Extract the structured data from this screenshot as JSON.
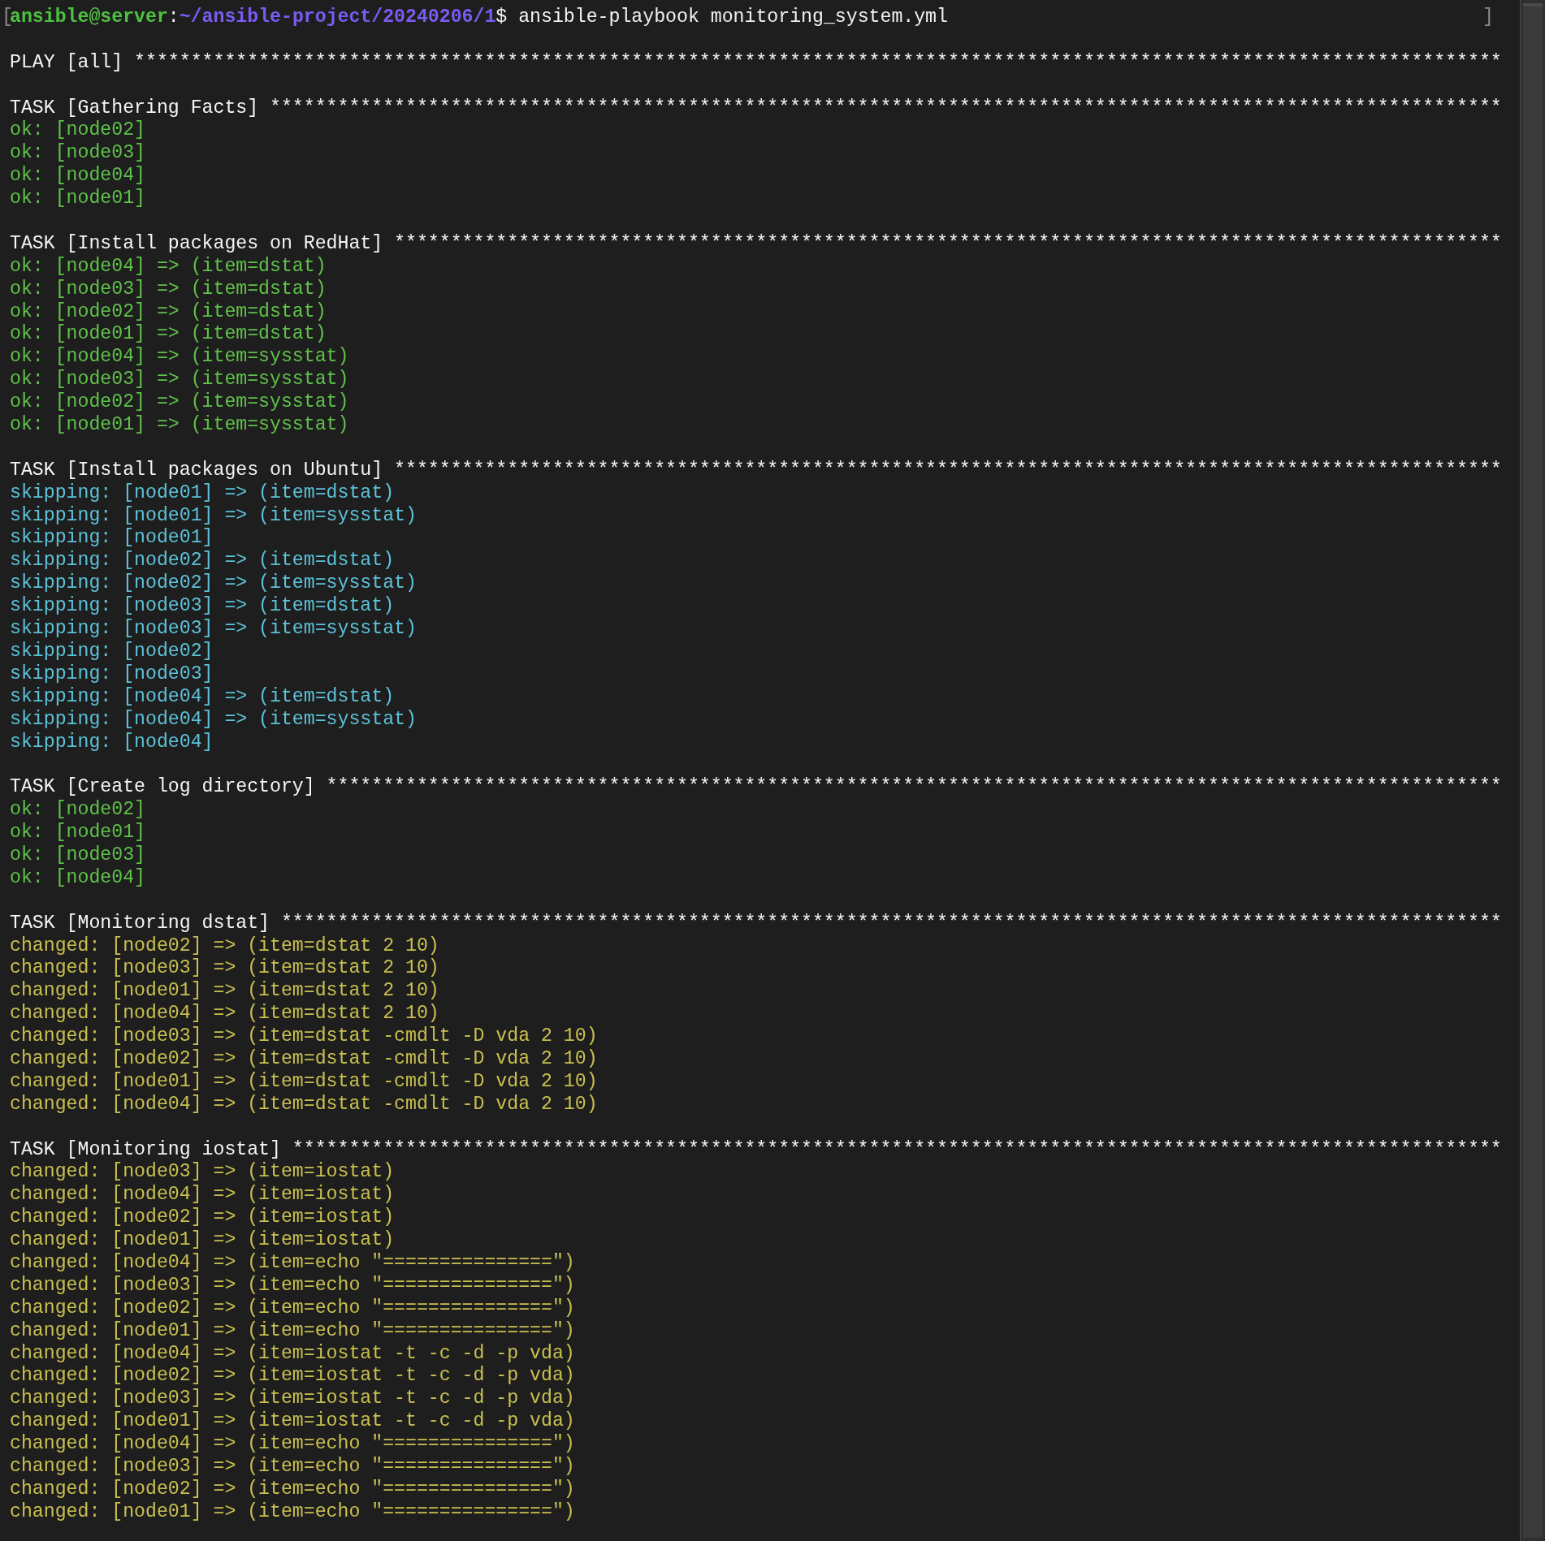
{
  "prompt": {
    "mark_open": "[",
    "user_host": "ansible@server",
    "separator": ":",
    "path": "~/ansible-project/20240206/1",
    "command": "$ ansible-playbook monitoring_system.yml",
    "mark_close": "]"
  },
  "sections": [
    {
      "header": "PLAY [all] *************************************************************************************************************************"
    },
    {
      "header": "TASK [Gathering Facts] *************************************************************************************************************",
      "results": [
        {
          "kind": "ok",
          "text": "ok: [node02]"
        },
        {
          "kind": "ok",
          "text": "ok: [node03]"
        },
        {
          "kind": "ok",
          "text": "ok: [node04]"
        },
        {
          "kind": "ok",
          "text": "ok: [node01]"
        }
      ]
    },
    {
      "header": "TASK [Install packages on RedHat] **************************************************************************************************",
      "results": [
        {
          "kind": "ok",
          "text": "ok: [node04] => (item=dstat)"
        },
        {
          "kind": "ok",
          "text": "ok: [node03] => (item=dstat)"
        },
        {
          "kind": "ok",
          "text": "ok: [node02] => (item=dstat)"
        },
        {
          "kind": "ok",
          "text": "ok: [node01] => (item=dstat)"
        },
        {
          "kind": "ok",
          "text": "ok: [node04] => (item=sysstat)"
        },
        {
          "kind": "ok",
          "text": "ok: [node03] => (item=sysstat)"
        },
        {
          "kind": "ok",
          "text": "ok: [node02] => (item=sysstat)"
        },
        {
          "kind": "ok",
          "text": "ok: [node01] => (item=sysstat)"
        }
      ]
    },
    {
      "header": "TASK [Install packages on Ubuntu] **************************************************************************************************",
      "results": [
        {
          "kind": "skipping",
          "text": "skipping: [node01] => (item=dstat)"
        },
        {
          "kind": "skipping",
          "text": "skipping: [node01] => (item=sysstat)"
        },
        {
          "kind": "skipping",
          "text": "skipping: [node01]"
        },
        {
          "kind": "skipping",
          "text": "skipping: [node02] => (item=dstat)"
        },
        {
          "kind": "skipping",
          "text": "skipping: [node02] => (item=sysstat)"
        },
        {
          "kind": "skipping",
          "text": "skipping: [node03] => (item=dstat)"
        },
        {
          "kind": "skipping",
          "text": "skipping: [node03] => (item=sysstat)"
        },
        {
          "kind": "skipping",
          "text": "skipping: [node02]"
        },
        {
          "kind": "skipping",
          "text": "skipping: [node03]"
        },
        {
          "kind": "skipping",
          "text": "skipping: [node04] => (item=dstat)"
        },
        {
          "kind": "skipping",
          "text": "skipping: [node04] => (item=sysstat)"
        },
        {
          "kind": "skipping",
          "text": "skipping: [node04]"
        }
      ]
    },
    {
      "header": "TASK [Create log directory] ********************************************************************************************************",
      "results": [
        {
          "kind": "ok",
          "text": "ok: [node02]"
        },
        {
          "kind": "ok",
          "text": "ok: [node01]"
        },
        {
          "kind": "ok",
          "text": "ok: [node03]"
        },
        {
          "kind": "ok",
          "text": "ok: [node04]"
        }
      ]
    },
    {
      "header": "TASK [Monitoring dstat] ************************************************************************************************************",
      "results": [
        {
          "kind": "changed",
          "text": "changed: [node02] => (item=dstat 2 10)"
        },
        {
          "kind": "changed",
          "text": "changed: [node03] => (item=dstat 2 10)"
        },
        {
          "kind": "changed",
          "text": "changed: [node01] => (item=dstat 2 10)"
        },
        {
          "kind": "changed",
          "text": "changed: [node04] => (item=dstat 2 10)"
        },
        {
          "kind": "changed",
          "text": "changed: [node03] => (item=dstat -cmdlt -D vda 2 10)"
        },
        {
          "kind": "changed",
          "text": "changed: [node02] => (item=dstat -cmdlt -D vda 2 10)"
        },
        {
          "kind": "changed",
          "text": "changed: [node01] => (item=dstat -cmdlt -D vda 2 10)"
        },
        {
          "kind": "changed",
          "text": "changed: [node04] => (item=dstat -cmdlt -D vda 2 10)"
        }
      ]
    },
    {
      "header": "TASK [Monitoring iostat] ***********************************************************************************************************",
      "results": [
        {
          "kind": "changed",
          "text": "changed: [node03] => (item=iostat)"
        },
        {
          "kind": "changed",
          "text": "changed: [node04] => (item=iostat)"
        },
        {
          "kind": "changed",
          "text": "changed: [node02] => (item=iostat)"
        },
        {
          "kind": "changed",
          "text": "changed: [node01] => (item=iostat)"
        },
        {
          "kind": "changed",
          "text": "changed: [node04] => (item=echo \"===============\")"
        },
        {
          "kind": "changed",
          "text": "changed: [node03] => (item=echo \"===============\")"
        },
        {
          "kind": "changed",
          "text": "changed: [node02] => (item=echo \"===============\")"
        },
        {
          "kind": "changed",
          "text": "changed: [node01] => (item=echo \"===============\")"
        },
        {
          "kind": "changed",
          "text": "changed: [node04] => (item=iostat -t -c -d -p vda)"
        },
        {
          "kind": "changed",
          "text": "changed: [node02] => (item=iostat -t -c -d -p vda)"
        },
        {
          "kind": "changed",
          "text": "changed: [node03] => (item=iostat -t -c -d -p vda)"
        },
        {
          "kind": "changed",
          "text": "changed: [node01] => (item=iostat -t -c -d -p vda)"
        },
        {
          "kind": "changed",
          "text": "changed: [node04] => (item=echo \"===============\")"
        },
        {
          "kind": "changed",
          "text": "changed: [node03] => (item=echo \"===============\")"
        },
        {
          "kind": "changed",
          "text": "changed: [node02] => (item=echo \"===============\")"
        },
        {
          "kind": "changed",
          "text": "changed: [node01] => (item=echo \"===============\")"
        }
      ]
    }
  ]
}
